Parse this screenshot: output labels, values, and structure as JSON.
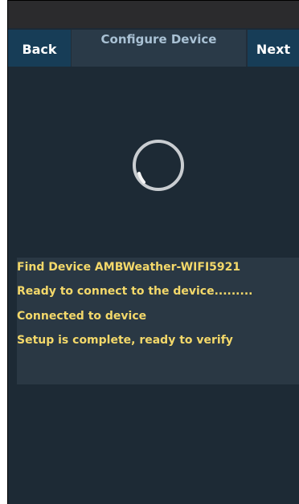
{
  "nav": {
    "back_label": "Back",
    "title": "Configure Device",
    "next_label": "Next"
  },
  "status_log": [
    "Find Device AMBWeather-WIFI5921",
    "Ready to connect to the device.........",
    "Connected to device",
    "Setup is complete, ready to verify"
  ],
  "colors": {
    "background": "#1d2a35",
    "nav_button": "#173d57",
    "log_text": "#f3d86a",
    "title_text": "#a9c1d4"
  }
}
